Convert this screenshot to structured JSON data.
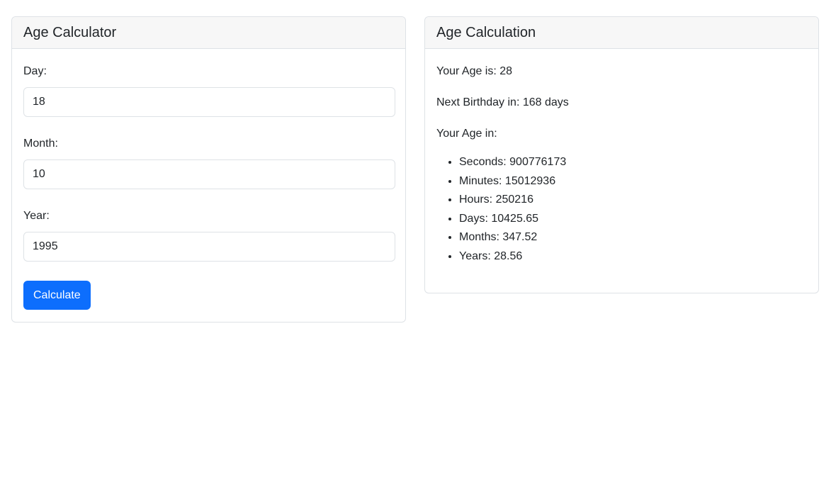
{
  "calculator": {
    "title": "Age Calculator",
    "fields": [
      {
        "label": "Day:",
        "value": "18"
      },
      {
        "label": "Month:",
        "value": "10"
      },
      {
        "label": "Year:",
        "value": "1995"
      }
    ],
    "button_label": "Calculate",
    "button_color": "#0d6efd"
  },
  "result": {
    "title": "Age Calculation",
    "age_line": "Your Age is: 28",
    "next_birthday_line": "Next Birthday in: 168 days",
    "age_in_label": "Your Age in:",
    "units": [
      "Seconds: 900776173",
      "Minutes: 15012936",
      "Hours: 250216",
      "Days: 10425.65",
      "Months: 347.52",
      "Years: 28.56"
    ]
  }
}
